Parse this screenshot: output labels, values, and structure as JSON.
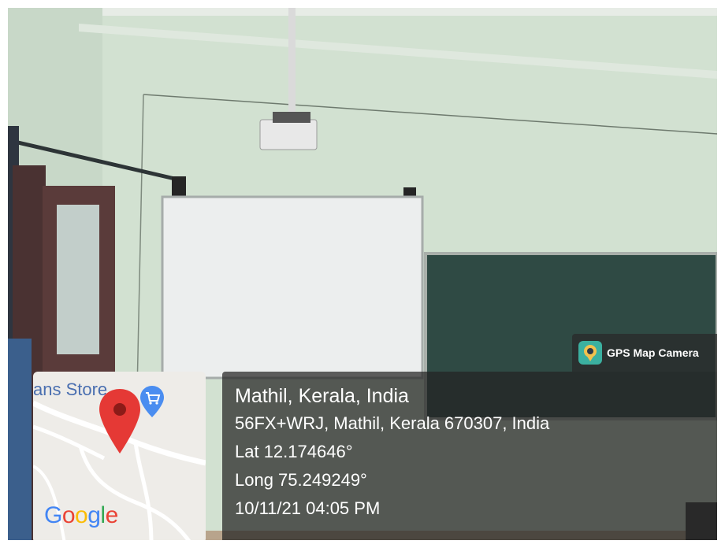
{
  "overlay": {
    "app_name": "GPS Map Camera",
    "app_icon": "location-pin-icon",
    "location_title": "Mathil, Kerala, India",
    "address": "56FX+WRJ, Mathil, Kerala 670307, India",
    "latitude": "Lat 12.174646°",
    "longitude": "Long 75.249249°",
    "timestamp": "10/11/21 04:05 PM"
  },
  "map": {
    "place_label": "ans Store",
    "provider_logo": "Google",
    "marker_icon": "map-marker-icon",
    "poi_icon": "shopping-cart-icon"
  },
  "colors": {
    "wall": "#d3e2d3",
    "marker": "#e53935",
    "poi": "#4a8df0"
  }
}
